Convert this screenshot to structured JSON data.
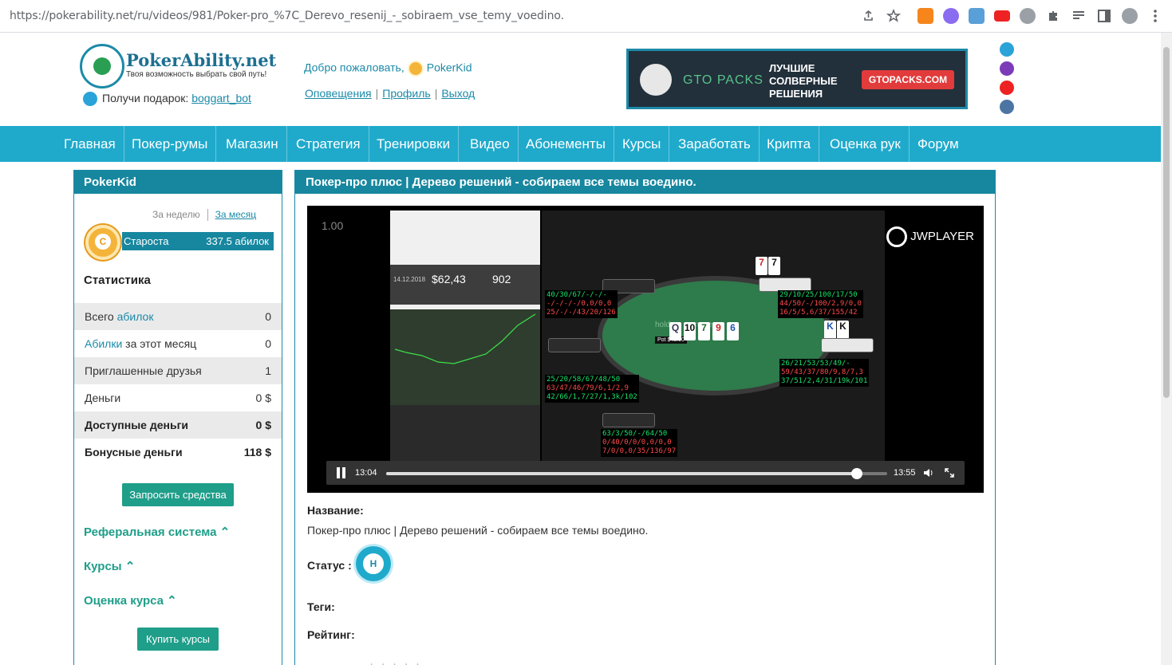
{
  "browser": {
    "url": "https://pokerability.net/ru/videos/981/Poker-pro_%7C_Derevo_resenij_-_sobiraem_vse_temy_voedino."
  },
  "header": {
    "logo_text": "PokerAbility.net",
    "logo_tagline": "Твоя возможность выбрать свой путь!",
    "gift_prefix": "Получи подарок:",
    "gift_link": "boggart_bot",
    "welcome": "Добро пожаловать,",
    "username": "PokerKid",
    "links": [
      "Оповещения",
      "Профиль",
      "Выход"
    ],
    "banner": {
      "brand": "GTO PACKS",
      "tagline": "ЛУЧШИЕ СОЛВЕРНЫЕ РЕШЕНИЯ",
      "button": "GTOPACKS.COM"
    }
  },
  "nav": [
    "Главная",
    "Покер-румы",
    "Магазин",
    "Стратегия",
    "Тренировки",
    "Видео",
    "Абонементы",
    "Курсы",
    "Заработать",
    "Крипта",
    "Оценка рук",
    "Форум"
  ],
  "sidebar": {
    "title": "PokerKid",
    "period_week": "За неделю",
    "period_month": "За месяц",
    "rank_letter": "C",
    "rank_name": "Староста",
    "rank_points": "337.5 абилок",
    "stats_title": "Статистика",
    "stats": [
      {
        "label_a": "Всего ",
        "label_b": "абилок",
        "label_c": "",
        "value": "0"
      },
      {
        "label_a": "",
        "label_b": "Абилки",
        "label_c": " за этот месяц",
        "value": "0"
      },
      {
        "label_a": "Приглашенные друзья",
        "label_b": "",
        "label_c": "",
        "value": "1"
      },
      {
        "label_a": "Деньги",
        "label_b": "",
        "label_c": "",
        "value": "0 $"
      },
      {
        "label_a": "Доступные деньги",
        "label_b": "",
        "label_c": "",
        "value": "0 $"
      },
      {
        "label_a": "Бонусные деньги",
        "label_b": "",
        "label_c": "",
        "value": "118 $"
      }
    ],
    "request_button": "Запросить средства",
    "accordions": [
      "Реферальная система",
      "Курсы",
      "Оценка курса"
    ],
    "buy_button": "Купить курсы"
  },
  "main": {
    "title": "Покер-про плюс | Дерево решений - собираем все темы воедино.",
    "player": {
      "corner_number": "1.00",
      "brand": "JWPLAYER",
      "elapsed": "13:04",
      "duration": "13:55",
      "progress": 0.94,
      "app_balance": "$62,43",
      "app_hands": "902",
      "app_date": "14.12.2018",
      "table_watermark": "holdem manager",
      "pot": "Pot $43.00",
      "board": [
        "Q",
        "10",
        "7",
        "9",
        "6"
      ],
      "hero_cards": [
        "K",
        "K"
      ],
      "villain_cards": [
        "7",
        "7"
      ],
      "huds": [
        {
          "line1": "40/30/67/-/-/-",
          "line2": "-/-/-/-/0,0/0,0",
          "line3": "25/-/-/43/20/126"
        },
        {
          "line1": "29/10/25/100/17/50",
          "line2": "44/50/-/100/2,9/0,0",
          "line3": "16/5/5,6/37/155/42"
        },
        {
          "line1": "25/20/58/67/48/50",
          "line2": "63/47/46/79/6,1/2,9",
          "line3": "42/66/1,7/27/1,3k/102"
        },
        {
          "line1": "26/21/53/53/49/-",
          "line2": "59/43/37/80/9,8/7,3",
          "line3": "37/51/2,4/31/19k/101"
        },
        {
          "line1": "63/3/50/-/64/50",
          "line2": "0/40/0/0/0,0/0,0",
          "line3": "7/0/0,0/35/136/97"
        }
      ]
    },
    "name_label": "Название:",
    "name_value": "Покер-про плюс | Дерево решений - собираем все темы воедино.",
    "status_label": "Статус :",
    "status_letter": "Н",
    "tags_label": "Теги:",
    "rating_label": "Рейтинг:",
    "rating_stars": "★★★★★"
  }
}
